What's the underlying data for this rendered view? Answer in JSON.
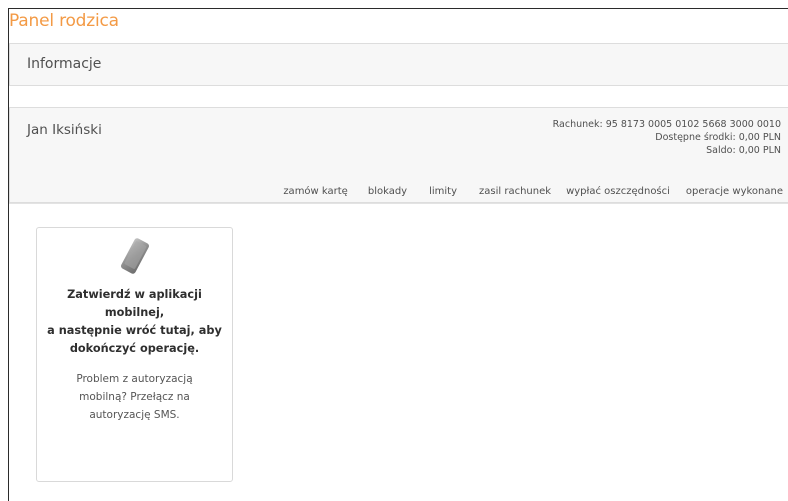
{
  "page": {
    "title": "Panel rodzica"
  },
  "info_panel": {
    "title": "Informacje"
  },
  "account": {
    "owner_name": "Jan Iksiński",
    "account_line": "Rachunek: 95 8173 0005 0102 5668 3000 0010",
    "available_line": "Dostępne środki: 0,00 PLN",
    "balance_line": "Saldo: 0,00 PLN",
    "actions": [
      {
        "label": "zamów kartę"
      },
      {
        "label": "blokady"
      },
      {
        "label": "limity"
      },
      {
        "label": "zasil rachunek"
      },
      {
        "label": "wypłać oszczędności"
      },
      {
        "label": "operacje wykonane"
      }
    ]
  },
  "auth_card": {
    "icon": "mobile-phone-icon",
    "main_line1": "Zatwierdź w aplikacji",
    "main_line2": "mobilnej,",
    "main_line3": "a następnie wróć tutaj, aby",
    "main_line4": "dokończyć operację.",
    "sub_line1": "Problem z autoryzacją",
    "sub_line2": "mobilną? Przełącz na",
    "sub_line3": "autoryzację SMS."
  },
  "colors": {
    "accent": "#f39a45",
    "panel_bg": "#f7f7f7",
    "border": "#dddddd"
  }
}
